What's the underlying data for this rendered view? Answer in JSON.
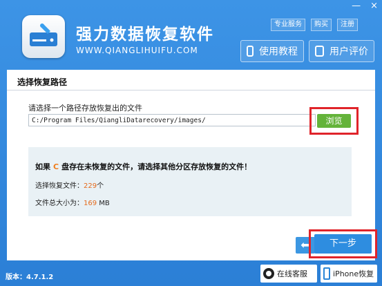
{
  "window": {
    "minimize": "—",
    "close": "×"
  },
  "header": {
    "title": "强力数据恢复软件",
    "url": "WWW.QIANGLIHUIFU.COM",
    "top_links": [
      "专业服务",
      "购买",
      "注册"
    ],
    "tutorial_button": "使用教程",
    "review_button": "用户评价"
  },
  "panel": {
    "section_title": "选择恢复路径",
    "path_label": "请选择一个路径存放恢复出的文件",
    "path_value": "C:/Program Files/QiangliDatarecovery/images/",
    "browse_button": "浏览",
    "info": {
      "prefix": "如果",
      "drive": "C",
      "suffix": "盘存在未恢复的文件，请选择其他分区存放恢复的文件！",
      "selected_label": "选择恢复文件：",
      "selected_count": "229",
      "selected_unit": "个",
      "size_label": "文件总大小为：",
      "size_value": "169",
      "size_unit": " MB"
    },
    "back_glyph": "⬅",
    "next_button": "下一步"
  },
  "footer": {
    "version": "版本：4.7.1.2",
    "online_service": "在线客服",
    "iphone_recovery": "iPhone恢复"
  },
  "colors": {
    "header_blue": "#2b7fd6",
    "browse_green": "#64b33a",
    "highlight_red": "#e0242a",
    "number_orange": "#e56a1c"
  }
}
